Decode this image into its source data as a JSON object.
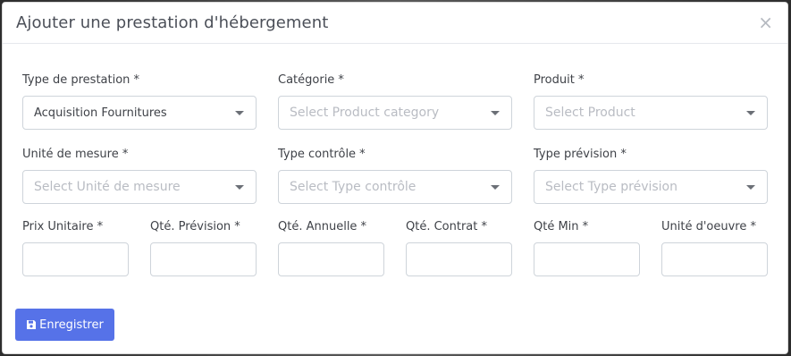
{
  "modal": {
    "title": "Ajouter une prestation d'hébergement",
    "close_glyph": "×"
  },
  "form": {
    "type_prestation": {
      "label": "Type de prestation *",
      "value": "Acquisition Fournitures"
    },
    "categorie": {
      "label": "Catégorie *",
      "placeholder": "Select Product category"
    },
    "produit": {
      "label": "Produit *",
      "placeholder": "Select Product"
    },
    "unite_mesure": {
      "label": "Unité de mesure *",
      "placeholder": "Select Unité de mesure"
    },
    "type_controle": {
      "label": "Type contrôle *",
      "placeholder": "Select Type contrôle"
    },
    "type_prevision": {
      "label": "Type prévision *",
      "placeholder": "Select Type prévision"
    },
    "prix_unitaire": {
      "label": "Prix Unitaire *",
      "value": ""
    },
    "qte_prevision": {
      "label": "Qté. Prévision *",
      "value": ""
    },
    "qte_annuelle": {
      "label": "Qté. Annuelle *",
      "value": ""
    },
    "qte_contrat": {
      "label": "Qté. Contrat *",
      "value": ""
    },
    "qte_min": {
      "label": "Qté Min *",
      "value": ""
    },
    "unite_oeuvre": {
      "label": "Unité d'oeuvre *",
      "value": ""
    }
  },
  "actions": {
    "save_label": "Enregistrer",
    "save_icon": "floppy-disk-icon",
    "accent_color": "#5672e8"
  }
}
